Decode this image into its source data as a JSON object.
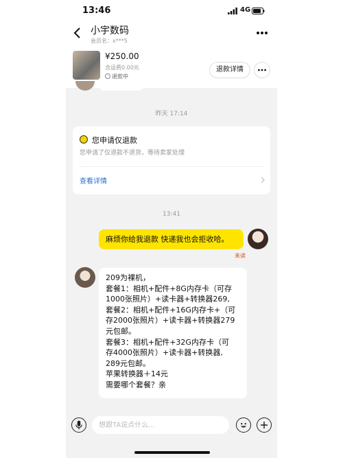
{
  "status_bar": {
    "time": "13:46",
    "network": "4G"
  },
  "header": {
    "shop_name": "小宇数码",
    "member_label": "会员名：x***5"
  },
  "product": {
    "price": "¥250.00",
    "shipping": "含运费0.00元",
    "refund_status": "退款中",
    "refund_detail_button": "退款详情"
  },
  "messages": {
    "timestamp_1": "昨天 17:14",
    "refund_card": {
      "title": "您申请仅退款",
      "description": "您申请了仅退款不退货，等待卖家处理",
      "link": "查看详情"
    },
    "timestamp_2": "13:41",
    "my_message": "麻烦你给我退款 快递我也会拒收哈。",
    "my_message_status": "未读",
    "seller_reply_lines": [
      "209为裸机，",
      "套餐1：相机+配件+8G内存卡（可存",
      "1000张照片）+读卡器+转换器269,",
      "套餐2：相机+配件+16G内存卡+（可",
      "存2000张照片）+读卡器+转换器279",
      "元包邮。",
      "套餐3：相机+配件+32G内存卡（可",
      "存4000张照片）+读卡器+转换器,",
      "289元包邮。",
      "苹果转换器＋14元",
      "需要哪个套餐？亲"
    ]
  },
  "input": {
    "placeholder": "想跟TA说点什么..."
  },
  "colors": {
    "my_bubble": "#ffe400",
    "link": "#2c6fd1",
    "unread": "#e24a1a",
    "chat_bg": "#f2f2f2"
  }
}
